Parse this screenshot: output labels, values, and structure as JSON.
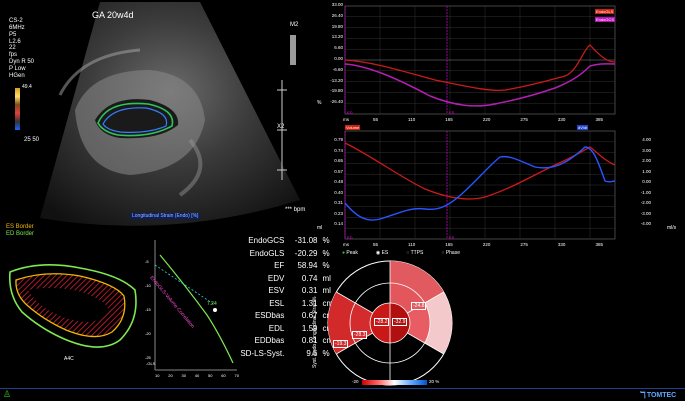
{
  "ultrasound": {
    "ga": "GA 20w4d",
    "probe": "CS-2",
    "freq": "6MHz",
    "p1": "P5",
    "p2": "L2.6",
    "p3": "22",
    "p4": "fps",
    "p5": "Dyn R 50",
    "p6": "P Low",
    "p7": "HGen",
    "m2": "M2",
    "x2": "X2",
    "bpm": "*** bpm",
    "scale_top": "49.4",
    "scale_bottom": "25 50",
    "strain_label": "Longitudinal Strain (Endo) [%]"
  },
  "legend": {
    "es": "ES Border",
    "ed": "ED Border"
  },
  "view_label": "A4C",
  "volume_plot": {
    "title": "EndoGLS-Volume-Correlation",
    "marker": "7.24",
    "x_ticks": [
      "10",
      "20",
      "30",
      "40",
      "50",
      "60",
      "70"
    ],
    "y_ticks": [
      "-5",
      "-10",
      "-15",
      "-20",
      "-25"
    ],
    "y_label": "-GLS"
  },
  "stats": [
    {
      "label": "EndoGCS",
      "value": "-31.08",
      "unit": "%"
    },
    {
      "label": "EndoGLS",
      "value": "-20.29",
      "unit": "%"
    },
    {
      "label": "EF",
      "value": "58.94",
      "unit": "%"
    },
    {
      "label": "EDV",
      "value": "0.74",
      "unit": "ml"
    },
    {
      "label": "ESV",
      "value": "0.31",
      "unit": "ml"
    },
    {
      "label": "ESL",
      "value": "1.31",
      "unit": "cm"
    },
    {
      "label": "ESDbas",
      "value": "0.67",
      "unit": "cm"
    },
    {
      "label": "EDL",
      "value": "1.59",
      "unit": "cm"
    },
    {
      "label": "EDDbas",
      "value": "0.81",
      "unit": "cm"
    },
    {
      "label": "SD-LS-Syst.",
      "value": "9.6",
      "unit": "%"
    }
  ],
  "strain_chart": {
    "y_ticks": [
      "33.00",
      "26.40",
      "19.80",
      "13.20",
      "6.60",
      "0.00",
      "-6.60",
      "-13.20",
      "-19.80",
      "-26.40",
      "-33.00"
    ],
    "x_ticks": [
      "55",
      "110",
      "165",
      "220",
      "275",
      "330",
      "385"
    ],
    "x_start": "ms",
    "unit": "%",
    "tag1": "EndoGLS",
    "tag2": "EndoGCS",
    "marker_ed": "ED",
    "marker_es": "ES"
  },
  "volume_chart": {
    "left_ticks": [
      "0.79",
      "0.74",
      "0.65",
      "0.57",
      "0.48",
      "0.40",
      "0.31",
      "0.23",
      "0.14",
      "0.06"
    ],
    "right_ticks": [
      "5.00",
      "4.00",
      "3.00",
      "2.00",
      "1.00",
      "0.00",
      "-1.00",
      "-2.00",
      "-3.00",
      "-4.00",
      "-5.00"
    ],
    "x_ticks": [
      "55",
      "110",
      "165",
      "220",
      "275",
      "330",
      "385"
    ],
    "x_start": "ms",
    "left_unit": "ml",
    "right_unit": "ml/s",
    "tag_volume": "Volume",
    "tag_rate": "dV/dt",
    "marker_ed": "ED",
    "marker_es": "ES"
  },
  "phase_legend": {
    "peak": "Peak",
    "es": "ES",
    "ttps": "TTPS",
    "phase": "Phase"
  },
  "bullseye": {
    "title": "Syst. Endo Longitudinal Strain%",
    "values": {
      "inner_left": "-28.2",
      "inner_right": "-32.9",
      "mid_right": "-24.8",
      "outer_left": "-19.3",
      "mid_left": "-28.3"
    },
    "scale_min": "-20",
    "scale_max": "20 %"
  },
  "logo": "TOMTEC"
}
